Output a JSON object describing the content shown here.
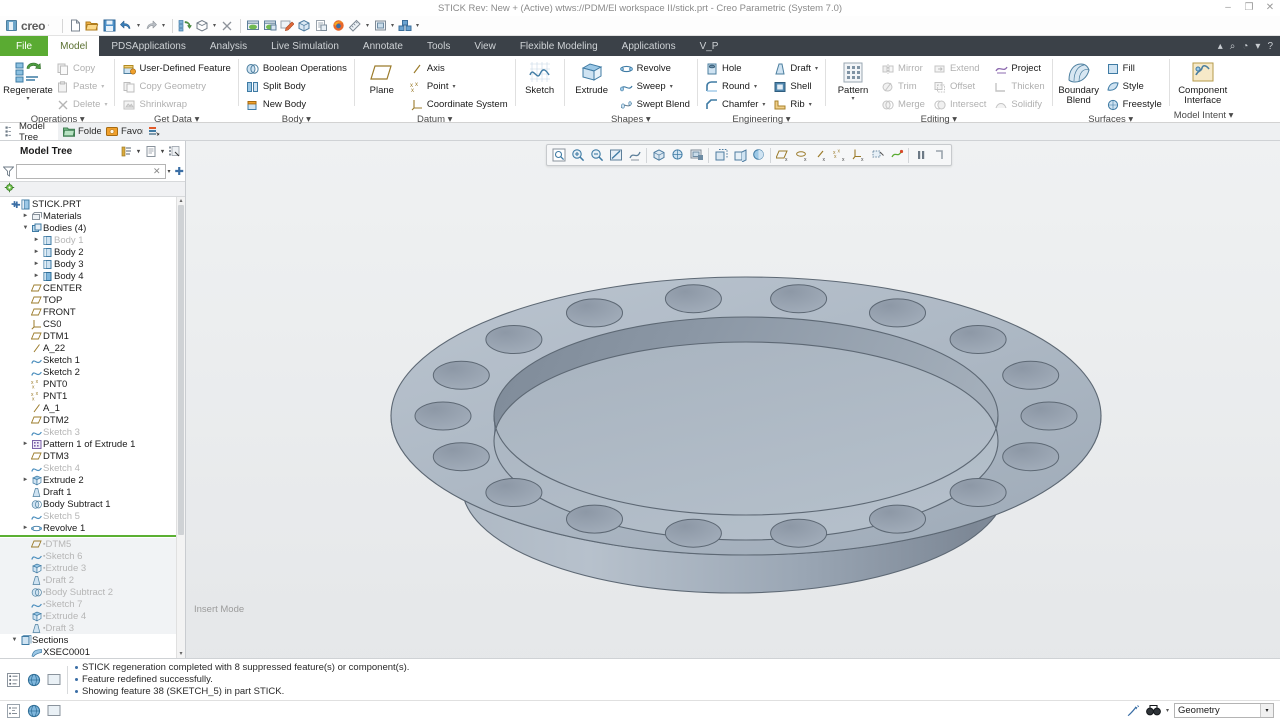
{
  "window": {
    "title": "STICK Rev: New + (Active) wtws://PDM/El workspace II/stick.prt - Creo Parametric (System 7.0)",
    "minimize": "–",
    "restore": "❐",
    "close": "✕"
  },
  "brand": {
    "name": "creo",
    "trademark": "·"
  },
  "quick_access": {
    "buttons": [
      {
        "name": "new-file-icon",
        "glyph": "new"
      },
      {
        "name": "open-file-icon",
        "glyph": "open"
      },
      {
        "name": "save-icon",
        "glyph": "save"
      },
      {
        "name": "undo-icon",
        "glyph": "undo"
      },
      {
        "name": "redo-icon",
        "glyph": "redo"
      },
      {
        "name": "regenerate-icon",
        "glyph": "regen"
      },
      {
        "name": "repaint-icon",
        "glyph": "repaint"
      },
      {
        "name": "close-window-icon",
        "glyph": "closewin"
      },
      {
        "name": "window-1-icon",
        "glyph": "win1"
      },
      {
        "name": "window-2-icon",
        "glyph": "win2"
      },
      {
        "name": "annotate-pen-icon",
        "glyph": "pen"
      },
      {
        "name": "view-manager-icon",
        "glyph": "viewmgr"
      },
      {
        "name": "copy-page-icon",
        "glyph": "page"
      },
      {
        "name": "browser-icon",
        "glyph": "fox"
      },
      {
        "name": "measure-icon",
        "glyph": "ruler"
      },
      {
        "name": "saved-views-icon",
        "glyph": "savedview"
      },
      {
        "name": "appearance-icon",
        "glyph": "appearance"
      }
    ]
  },
  "ribbon": {
    "tabs": [
      {
        "label": "File",
        "kind": "file"
      },
      {
        "label": "Model",
        "kind": "active"
      },
      {
        "label": "PDSApplications",
        "kind": "normal"
      },
      {
        "label": "Analysis",
        "kind": "normal"
      },
      {
        "label": "Live Simulation",
        "kind": "normal"
      },
      {
        "label": "Annotate",
        "kind": "normal"
      },
      {
        "label": "Tools",
        "kind": "normal"
      },
      {
        "label": "View",
        "kind": "normal"
      },
      {
        "label": "Flexible Modeling",
        "kind": "normal"
      },
      {
        "label": "Applications",
        "kind": "normal"
      },
      {
        "label": "V_P",
        "kind": "normal"
      }
    ],
    "right_icons": [
      {
        "name": "collapse-ribbon-icon",
        "glyph": "▴"
      },
      {
        "name": "search-icon",
        "glyph": "⌕"
      },
      {
        "name": "account-icon",
        "glyph": "◔"
      },
      {
        "name": "account-caret-icon",
        "glyph": "▾"
      },
      {
        "name": "help-icon",
        "glyph": "?"
      }
    ],
    "groups": [
      {
        "name": "operations",
        "label": "Operations",
        "big": {
          "label": "Regenerate",
          "icon": "regenerate-icon",
          "has_caret": true
        },
        "items": [
          {
            "label": "Copy",
            "icon": "copy-icon",
            "disabled": true,
            "caret": false
          },
          {
            "label": "Paste",
            "icon": "paste-icon",
            "disabled": true,
            "caret": true
          },
          {
            "label": "Delete",
            "icon": "delete-icon",
            "disabled": true,
            "caret": true
          }
        ]
      },
      {
        "name": "get-data",
        "label": "Get Data",
        "items": [
          {
            "label": "User-Defined Feature",
            "icon": "udf-icon",
            "disabled": false,
            "caret": false
          },
          {
            "label": "Copy Geometry",
            "icon": "copy-geometry-icon",
            "disabled": true,
            "caret": false
          },
          {
            "label": "Shrinkwrap",
            "icon": "shrinkwrap-icon",
            "disabled": true,
            "caret": false
          }
        ]
      },
      {
        "name": "body",
        "label": "Body",
        "items": [
          {
            "label": "Boolean Operations",
            "icon": "boolean-operations-icon",
            "disabled": false,
            "caret": false
          },
          {
            "label": "Split Body",
            "icon": "split-body-icon",
            "disabled": false,
            "caret": false
          },
          {
            "label": "New Body",
            "icon": "new-body-icon",
            "disabled": false,
            "caret": false
          }
        ]
      },
      {
        "name": "datum",
        "label": "Datum",
        "big": {
          "label": "Plane",
          "icon": "plane-icon",
          "has_caret": false
        },
        "items": [
          {
            "label": "Axis",
            "icon": "axis-icon",
            "disabled": false,
            "caret": false
          },
          {
            "label": "Point",
            "icon": "point-icon",
            "disabled": false,
            "caret": true
          },
          {
            "label": "Coordinate System",
            "icon": "coordinate-system-icon",
            "disabled": false,
            "caret": false
          }
        ]
      },
      {
        "name": "sketch",
        "label": "",
        "big": {
          "label": "Sketch",
          "icon": "sketch-icon",
          "has_caret": false
        }
      },
      {
        "name": "shapes",
        "label": "Shapes",
        "big": {
          "label": "Extrude",
          "icon": "extrude-icon",
          "has_caret": false
        },
        "items": [
          {
            "label": "Revolve",
            "icon": "revolve-icon",
            "disabled": false,
            "caret": false
          },
          {
            "label": "Sweep",
            "icon": "sweep-icon",
            "disabled": false,
            "caret": true
          },
          {
            "label": "Swept Blend",
            "icon": "swept-blend-icon",
            "disabled": false,
            "caret": false
          }
        ]
      },
      {
        "name": "engineering",
        "label": "Engineering",
        "items_a": [
          {
            "label": "Hole",
            "icon": "hole-icon",
            "disabled": false,
            "caret": false
          },
          {
            "label": "Round",
            "icon": "round-icon",
            "disabled": false,
            "caret": true
          },
          {
            "label": "Chamfer",
            "icon": "chamfer-icon",
            "disabled": false,
            "caret": true
          }
        ],
        "items_b": [
          {
            "label": "Draft",
            "icon": "draft-icon",
            "disabled": false,
            "caret": true
          },
          {
            "label": "Shell",
            "icon": "shell-icon",
            "disabled": false,
            "caret": false
          },
          {
            "label": "Rib",
            "icon": "rib-icon",
            "disabled": false,
            "caret": true
          }
        ]
      },
      {
        "name": "editing",
        "label": "Editing",
        "big": {
          "label": "Pattern",
          "icon": "pattern-icon",
          "has_caret": true
        },
        "items_a": [
          {
            "label": "Mirror",
            "icon": "mirror-icon",
            "disabled": true,
            "caret": false
          },
          {
            "label": "Trim",
            "icon": "trim-icon",
            "disabled": true,
            "caret": false
          },
          {
            "label": "Merge",
            "icon": "merge-icon",
            "disabled": true,
            "caret": false
          }
        ],
        "items_b": [
          {
            "label": "Extend",
            "icon": "extend-icon",
            "disabled": true,
            "caret": false
          },
          {
            "label": "Offset",
            "icon": "offset-icon",
            "disabled": true,
            "caret": false
          },
          {
            "label": "Intersect",
            "icon": "intersect-icon",
            "disabled": true,
            "caret": false
          }
        ],
        "items_c": [
          {
            "label": "Project",
            "icon": "project-icon",
            "disabled": false,
            "caret": false
          },
          {
            "label": "Thicken",
            "icon": "thicken-icon",
            "disabled": true,
            "caret": false
          },
          {
            "label": "Solidify",
            "icon": "solidify-icon",
            "disabled": true,
            "caret": false
          }
        ]
      },
      {
        "name": "surfaces",
        "label": "Surfaces",
        "big": {
          "label": "Boundary Blend",
          "icon": "boundary-blend-icon",
          "has_caret": false
        },
        "items": [
          {
            "label": "Fill",
            "icon": "fill-icon",
            "disabled": false,
            "caret": false
          },
          {
            "label": "Style",
            "icon": "style-icon",
            "disabled": false,
            "caret": false
          },
          {
            "label": "Freestyle",
            "icon": "freestyle-icon",
            "disabled": false,
            "caret": false
          }
        ]
      },
      {
        "name": "model-intent",
        "label": "Model Intent",
        "big": {
          "label": "Component Interface",
          "icon": "component-interface-icon",
          "has_caret": false
        }
      }
    ]
  },
  "nav_tabs": [
    {
      "label": "Model Tree",
      "icon": "model-tree-icon",
      "active": true
    },
    {
      "label": "Folder",
      "icon": "folder-browser-icon",
      "active": false
    },
    {
      "label": "Favori",
      "icon": "favorites-icon",
      "active": false
    },
    {
      "label": "",
      "icon": "layers-icon",
      "active": false
    }
  ],
  "model_tree": {
    "title": "Model Tree",
    "header_buttons": [
      {
        "name": "tree-filters-icon",
        "glyph": "filters"
      },
      {
        "name": "tree-settings-icon",
        "glyph": "settings"
      },
      {
        "name": "tree-display-icon",
        "glyph": "display"
      }
    ],
    "filter": {
      "value": "",
      "placeholder": ""
    },
    "column_icon": "refresh-icon",
    "nodes": [
      {
        "label": "STICK.PRT",
        "indent": 0,
        "icon": "part-icon",
        "expander": "plus",
        "suppressed": false
      },
      {
        "label": "Materials",
        "indent": 1,
        "icon": "materials-icon",
        "expander": "collapsed",
        "suppressed": false
      },
      {
        "label": "Bodies (4)",
        "indent": 1,
        "icon": "bodies-icon",
        "expander": "expanded",
        "suppressed": false
      },
      {
        "label": "Body 1",
        "indent": 2,
        "icon": "body-icon",
        "expander": "collapsed",
        "suppressed": true
      },
      {
        "label": "Body 2",
        "indent": 2,
        "icon": "body-icon",
        "expander": "collapsed",
        "suppressed": false
      },
      {
        "label": "Body 3",
        "indent": 2,
        "icon": "body-icon",
        "expander": "collapsed",
        "suppressed": false
      },
      {
        "label": "Body 4",
        "indent": 2,
        "icon": "body-active-icon",
        "expander": "collapsed",
        "suppressed": false
      },
      {
        "label": "CENTER",
        "indent": 1,
        "icon": "datum-plane-icon",
        "expander": "none",
        "suppressed": false
      },
      {
        "label": "TOP",
        "indent": 1,
        "icon": "datum-plane-icon",
        "expander": "none",
        "suppressed": false
      },
      {
        "label": "FRONT",
        "indent": 1,
        "icon": "datum-plane-icon",
        "expander": "none",
        "suppressed": false
      },
      {
        "label": "CS0",
        "indent": 1,
        "icon": "coordinate-system-icon",
        "expander": "none",
        "suppressed": false
      },
      {
        "label": "DTM1",
        "indent": 1,
        "icon": "datum-plane-icon",
        "expander": "none",
        "suppressed": false
      },
      {
        "label": "A_22",
        "indent": 1,
        "icon": "datum-axis-icon",
        "expander": "none",
        "suppressed": false
      },
      {
        "label": "Sketch 1",
        "indent": 1,
        "icon": "sketch-icon",
        "expander": "none",
        "suppressed": false
      },
      {
        "label": "Sketch 2",
        "indent": 1,
        "icon": "sketch-icon",
        "expander": "none",
        "suppressed": false
      },
      {
        "label": "PNT0",
        "indent": 1,
        "icon": "datum-point-icon",
        "expander": "none",
        "suppressed": false
      },
      {
        "label": "PNT1",
        "indent": 1,
        "icon": "datum-point-icon",
        "expander": "none",
        "suppressed": false
      },
      {
        "label": "A_1",
        "indent": 1,
        "icon": "datum-axis-icon",
        "expander": "none",
        "suppressed": false
      },
      {
        "label": "DTM2",
        "indent": 1,
        "icon": "datum-plane-icon",
        "expander": "none",
        "suppressed": false
      },
      {
        "label": "Sketch 3",
        "indent": 1,
        "icon": "sketch-icon",
        "expander": "none",
        "suppressed": true
      },
      {
        "label": "Pattern 1 of Extrude 1",
        "indent": 1,
        "icon": "pattern-icon",
        "expander": "collapsed",
        "suppressed": false
      },
      {
        "label": "DTM3",
        "indent": 1,
        "icon": "datum-plane-icon",
        "expander": "none",
        "suppressed": false
      },
      {
        "label": "Sketch 4",
        "indent": 1,
        "icon": "sketch-icon",
        "expander": "none",
        "suppressed": true
      },
      {
        "label": "Extrude 2",
        "indent": 1,
        "icon": "extrude-icon",
        "expander": "collapsed",
        "suppressed": false
      },
      {
        "label": "Draft 1",
        "indent": 1,
        "icon": "draft-icon",
        "expander": "none",
        "suppressed": false
      },
      {
        "label": "Body Subtract 1",
        "indent": 1,
        "icon": "body-subtract-icon",
        "expander": "none",
        "suppressed": false
      },
      {
        "label": "Sketch 5",
        "indent": 1,
        "icon": "sketch-icon",
        "expander": "none",
        "suppressed": true
      },
      {
        "label": "Revolve 1",
        "indent": 1,
        "icon": "revolve-icon",
        "expander": "collapsed",
        "suppressed": false
      }
    ],
    "inserted_nodes": [
      {
        "label": "DTM5",
        "indent": 1,
        "icon": "datum-plane-icon",
        "marker": "▪"
      },
      {
        "label": "Sketch 6",
        "indent": 1,
        "icon": "sketch-icon",
        "marker": "▪"
      },
      {
        "label": "Extrude 3",
        "indent": 1,
        "icon": "extrude-icon",
        "marker": "▪"
      },
      {
        "label": "Draft 2",
        "indent": 1,
        "icon": "draft-icon",
        "marker": "▪"
      },
      {
        "label": "Body Subtract 2",
        "indent": 1,
        "icon": "body-subtract-icon",
        "marker": "▪"
      },
      {
        "label": "Sketch 7",
        "indent": 1,
        "icon": "sketch-icon",
        "marker": "▪"
      },
      {
        "label": "Extrude 4",
        "indent": 1,
        "icon": "extrude-icon",
        "marker": "▪"
      },
      {
        "label": "Draft 3",
        "indent": 1,
        "icon": "draft-icon",
        "marker": "▪"
      }
    ],
    "tail_nodes": [
      {
        "label": "Sections",
        "indent": 0,
        "icon": "sections-icon",
        "expander": "expanded",
        "suppressed": false
      },
      {
        "label": "XSEC0001",
        "indent": 1,
        "icon": "xsection-icon",
        "expander": "none",
        "suppressed": false
      }
    ]
  },
  "graphics_toolbar": {
    "buttons": [
      {
        "name": "refit-icon",
        "glyph": "refit"
      },
      {
        "name": "zoom-in-icon",
        "glyph": "zoomin"
      },
      {
        "name": "zoom-out-icon",
        "glyph": "zoomout"
      },
      {
        "name": "repaint-icon",
        "glyph": "repaint"
      },
      {
        "name": "datum-display-icon",
        "glyph": "datums"
      },
      {
        "name": "saved-orientations-icon",
        "glyph": "orient"
      },
      {
        "name": "view-manager-icon",
        "glyph": "viewmgr"
      },
      {
        "name": "named-views-icon",
        "glyph": "named"
      },
      {
        "name": "display-style-icon",
        "glyph": "style"
      },
      {
        "name": "perspective-icon",
        "glyph": "persp"
      },
      {
        "name": "appearance-gallery-icon",
        "glyph": "appear"
      },
      {
        "name": "plane-display-icon",
        "glyph": "planedisp"
      },
      {
        "name": "axis-display-icon",
        "glyph": "axisdisp"
      },
      {
        "name": "point-display-icon",
        "glyph": "pointdisp"
      },
      {
        "name": "csys-display-icon",
        "glyph": "csysdisp"
      },
      {
        "name": "annotation-display-icon",
        "glyph": "anndisp"
      },
      {
        "name": "spin-center-icon",
        "glyph": "spin"
      },
      {
        "name": "layer-display-icon",
        "glyph": "layerdisp"
      },
      {
        "name": "pause-icon",
        "glyph": "pause"
      },
      {
        "name": "stop-icon",
        "glyph": "stop"
      }
    ]
  },
  "viewport": {
    "insert_mode_label": "Insert Mode",
    "background_top": "#eef0f1",
    "background_bottom": "#e6e8ea",
    "model": {
      "name": "stick-ring-part",
      "hole_count": 18,
      "face_top": "#b3bdc9",
      "face_inner": "#8e99a7",
      "face_outer": "#9aa6b4",
      "edge_color": "#5a6470"
    }
  },
  "messages": {
    "icons": [
      {
        "name": "message-log-icon",
        "glyph": "log"
      },
      {
        "name": "web-link-icon",
        "glyph": "web"
      },
      {
        "name": "screen-icon",
        "glyph": "screen"
      }
    ],
    "lines": [
      "STICK regeneration completed with 8 suppressed feature(s) or component(s).",
      "Feature redefined successfully.",
      "Showing feature 38 (SKETCH_5) in part STICK."
    ]
  },
  "statusbar": {
    "left_icons": [
      {
        "name": "quick-sash-icon",
        "glyph": "sash"
      },
      {
        "name": "browser-toggle-icon",
        "glyph": "globe"
      },
      {
        "name": "navigator-toggle-icon",
        "glyph": "pane"
      }
    ],
    "right_icons": [
      {
        "name": "selection-filter-icon",
        "glyph": "selfilter"
      },
      {
        "name": "find-icon",
        "glyph": "find"
      },
      {
        "name": "find-caret-icon",
        "glyph": "▾"
      }
    ],
    "selection_filter": {
      "value": "Geometry",
      "caret": "▾"
    }
  }
}
